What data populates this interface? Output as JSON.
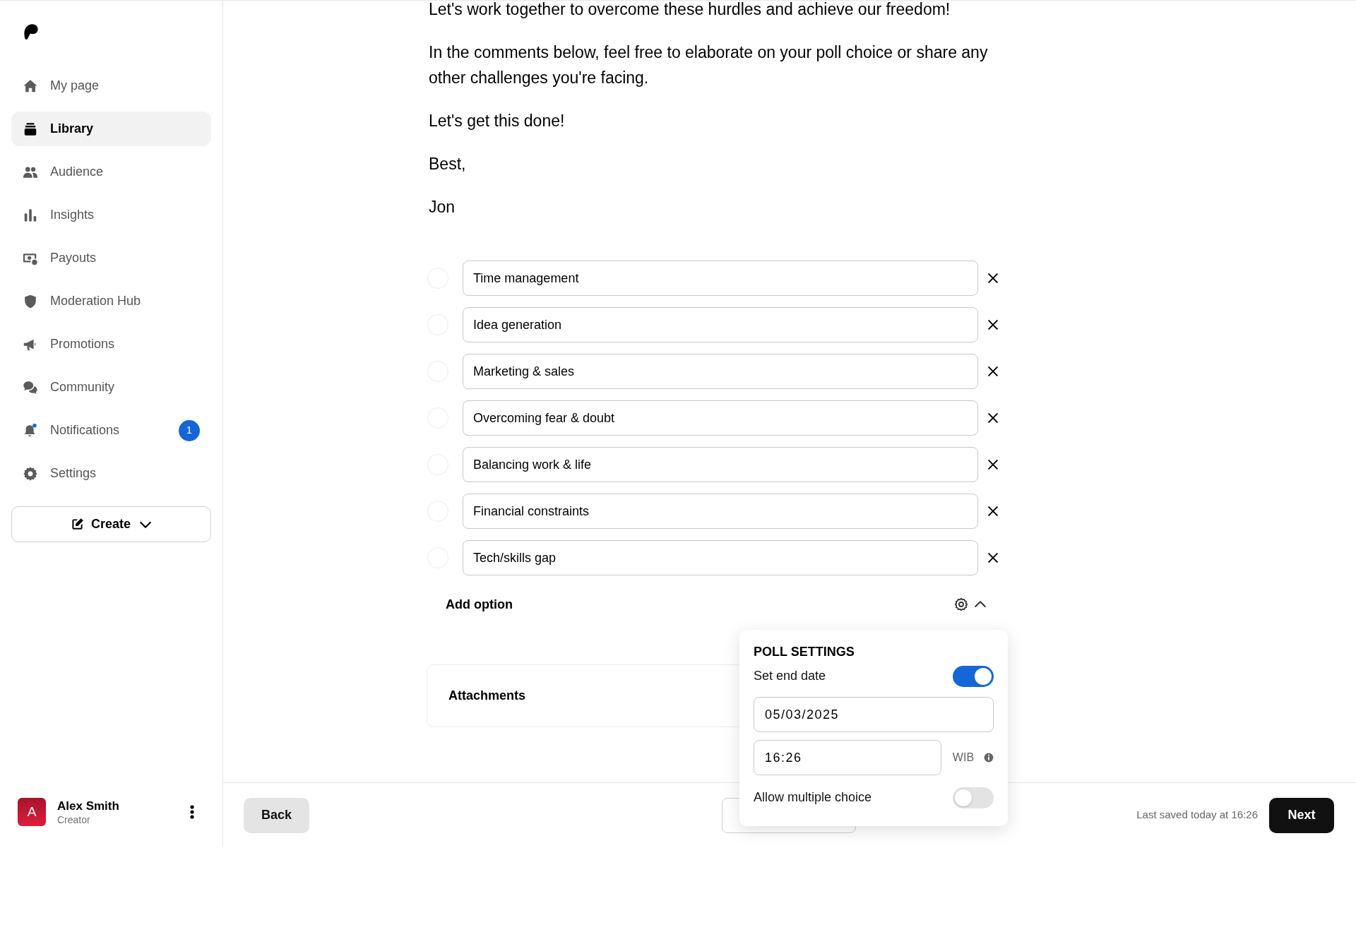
{
  "sidebar": {
    "items": [
      {
        "label": "My page",
        "selected": false
      },
      {
        "label": "Library",
        "selected": true
      },
      {
        "label": "Audience",
        "selected": false
      },
      {
        "label": "Insights",
        "selected": false
      },
      {
        "label": "Payouts",
        "selected": false
      },
      {
        "label": "Moderation Hub",
        "selected": false
      },
      {
        "label": "Promotions",
        "selected": false
      },
      {
        "label": "Community",
        "selected": false
      },
      {
        "label": "Notifications",
        "selected": false,
        "badge": "1"
      },
      {
        "label": "Settings",
        "selected": false
      }
    ],
    "create_button": {
      "label": "Create"
    },
    "user": {
      "initial": "A",
      "name": "Alex Smith",
      "role": "Creator"
    }
  },
  "post": {
    "paragraphs": [
      "Let's work together to overcome these hurdles and achieve our freedom!",
      "In the comments below, feel free to elaborate on your poll choice or share any other challenges you're facing.",
      "Let's get this done!",
      "Best,",
      "Jon"
    ]
  },
  "poll": {
    "options": [
      {
        "label": "Time management",
        "selected": false
      },
      {
        "label": "Idea generation",
        "selected": false
      },
      {
        "label": "Marketing & sales",
        "selected": false
      },
      {
        "label": "Overcoming fear & doubt",
        "selected": false
      },
      {
        "label": "Balancing work & life",
        "selected": false
      },
      {
        "label": "Financial constraints",
        "selected": false
      },
      {
        "label": "Tech/skills gap",
        "selected": false
      }
    ],
    "add_option": "Add option"
  },
  "attachments": {
    "title": "Attachments"
  },
  "poll_settings": {
    "title": "POLL SETTINGS",
    "end_date": {
      "label": "Set end date",
      "on": true
    },
    "date": "05/03/2025",
    "time": "16:26",
    "timezone": "WIB",
    "allow_multiple": {
      "label": "Allow multiple choice",
      "on": false
    }
  },
  "footer": {
    "back": "Back",
    "last_saved": "Last saved today at 16:26",
    "next": "Next"
  }
}
